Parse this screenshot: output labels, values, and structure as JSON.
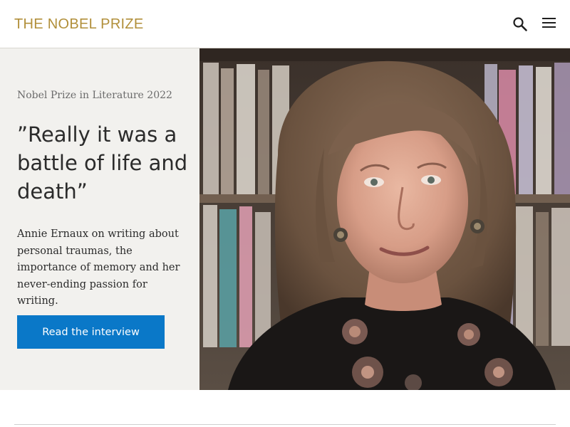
{
  "header": {
    "logo_text": "THE NOBEL PRIZE",
    "search_icon": "search-icon",
    "menu_icon": "hamburger-menu-icon"
  },
  "hero": {
    "eyebrow": "Nobel Prize in Literature 2022",
    "headline": "”Really it was a battle of life and death”",
    "summary": "Annie Ernaux on writing about personal traumas, the importance of memory and her never-ending passion for writing.",
    "cta_label": "Read the interview",
    "image_alt": "Portrait photo of Annie Ernaux in front of bookshelves"
  },
  "colors": {
    "brand_gold": "#b18f3a",
    "panel_bg": "#f2f1ee",
    "cta_blue": "#0a78c8",
    "text_dark": "#2b2b2b",
    "text_muted": "#6b6b6b"
  }
}
